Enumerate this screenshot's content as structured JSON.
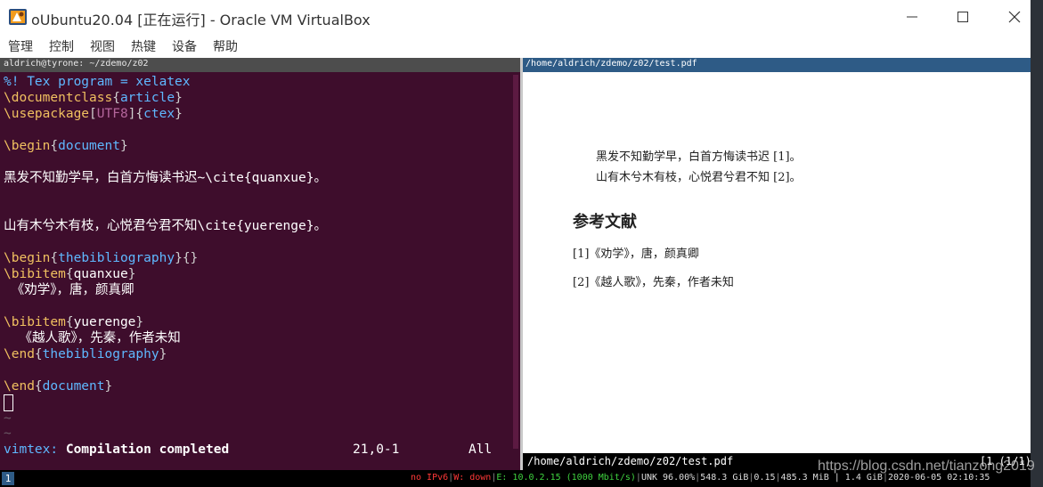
{
  "window": {
    "title": "oUbuntu20.04 [正在运行] - Oracle VM VirtualBox",
    "menu": [
      "管理",
      "控制",
      "视图",
      "热键",
      "设备",
      "帮助"
    ]
  },
  "terminal": {
    "header": "aldrich@tyrone: ~/zdemo/z02",
    "lines": {
      "l1": "%! Tex program = xelatex",
      "l2_cmd": "\\documentclass",
      "l2_arg": "article",
      "l3_cmd": "\\usepackage",
      "l3_opt": "UTF8",
      "l3_arg": "ctex",
      "l5_cmd": "\\begin",
      "l5_arg": "document",
      "l7": "黑发不知勤学早，白首方悔读书迟~\\cite{quanxue}。",
      "l10": "山有木兮木有枝，心悦君兮君不知\\cite{yuerenge}。",
      "l12_cmd": "\\begin",
      "l12_arg": "thebibliography",
      "l12_rest": "{}",
      "l13_cmd": "\\bibitem",
      "l13_arg": "quanxue",
      "l14": " 《劝学》，唐，颜真卿",
      "l16_cmd": "\\bibitem",
      "l16_arg": "yuerenge",
      "l17": "  《越人歌》，先秦，作者未知",
      "l18_cmd": "\\end",
      "l18_arg": "thebibliography",
      "l20_cmd": "\\end",
      "l20_arg": "document"
    },
    "tilde": "~",
    "status_label": "vimtex:",
    "status_message": "Compilation completed",
    "status_position": "21,0-1",
    "status_scroll": "All"
  },
  "pdf": {
    "header": "/home/aldrich/zdemo/z02/test.pdf",
    "line1": "黑发不知勤学早，白首方悔读书迟 [1]。",
    "line2": "山有木兮木有枝，心悦君兮君不知 [2]。",
    "heading": "参考文献",
    "ref1": "[1]《劝学》，唐，颜真卿",
    "ref2": "[2]《越人歌》，先秦，作者未知",
    "footer_path": "/home/aldrich/zdemo/z02/test.pdf",
    "footer_page": "[1 (1/1)"
  },
  "statusbar": {
    "workspace": "1",
    "ipv6": "no IPv6",
    "wifi": "W: down",
    "eth": "E: 10.0.2.15 (1000 Mbit/s)",
    "battery": "UNK 96.00%",
    "disk": "548.3 GiB",
    "load": "0.15",
    "mem": "485.3 MiB | 1.4 GiB",
    "datetime": "2020-06-05 02:10:35"
  },
  "watermark": "https://blog.csdn.net/tianzong2019",
  "colors": {
    "terminal_bg": "#3e0d2c",
    "keyword": "#f0c060",
    "argument": "#5fb8ff",
    "pdf_header": "#2e5b86"
  },
  "icons": [
    "virtualbox-icon",
    "minimize-icon",
    "maximize-icon",
    "close-icon"
  ]
}
